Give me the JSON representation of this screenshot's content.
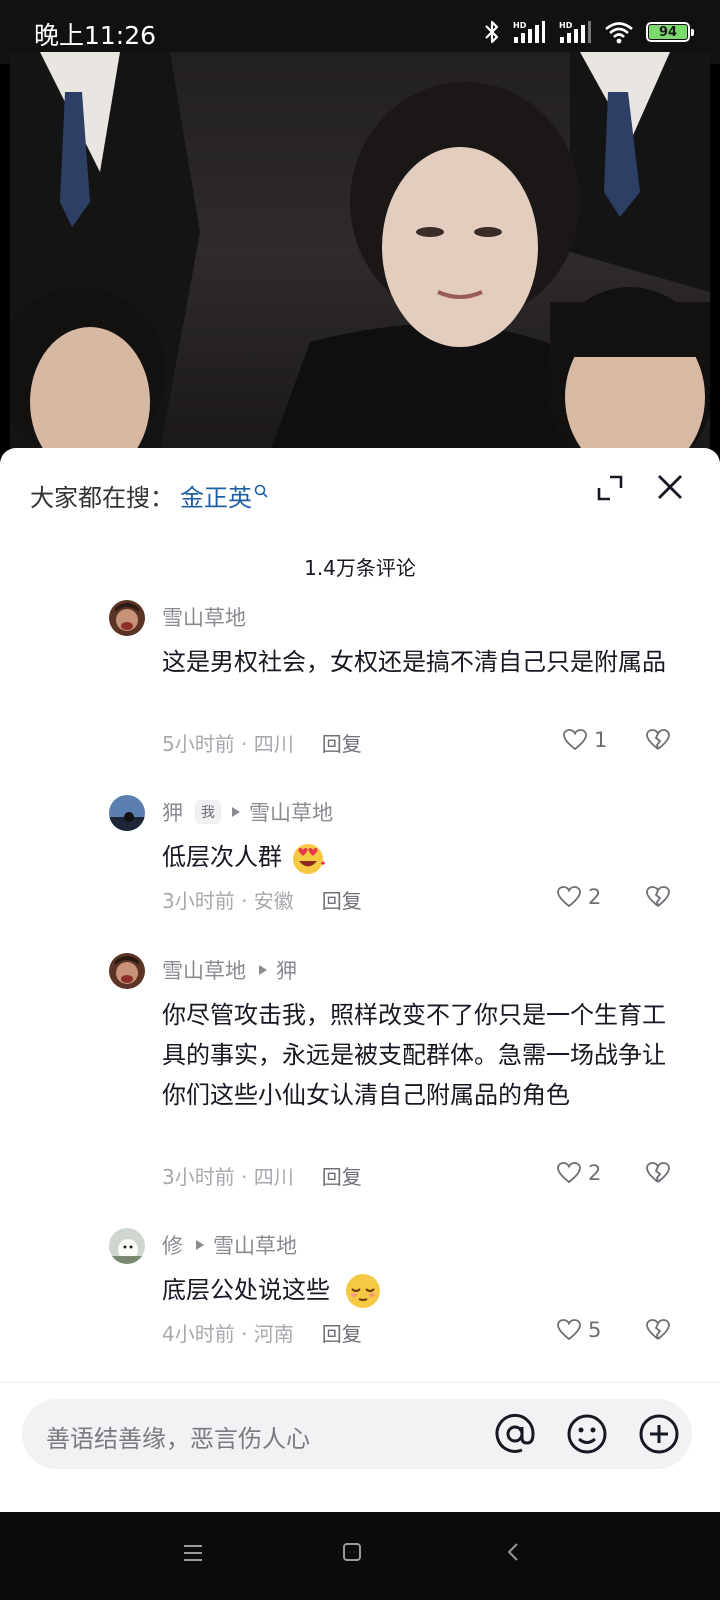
{
  "status_bar": {
    "time": "晚上11:26",
    "battery": "94"
  },
  "hot_search": {
    "prefix": "大家都在搜：",
    "term": "金正英"
  },
  "comments_header": {
    "count": "1.4万条评论"
  },
  "comments": [
    {
      "user": "雪山草地",
      "text": "这是男权社会，女权还是搞不清自己只是附属品",
      "time_location": "5小时前 · 四川",
      "reply_label": "回复",
      "likes": "1"
    },
    {
      "user": "狎",
      "badge": "我",
      "reply_to": "雪山草地",
      "text": "低层次人群",
      "time_location": "3小时前 · 安徽",
      "reply_label": "回复",
      "likes": "2"
    },
    {
      "user": "雪山草地",
      "reply_to": "狎",
      "text": "你尽管攻击我，照样改变不了你只是一个生育工具的事实，永远是被支配群体。急需一场战争让你们这些小仙女认清自己附属品的角色",
      "time_location": "3小时前 · 四川",
      "reply_label": "回复",
      "likes": "2"
    },
    {
      "user": "修",
      "reply_to": "雪山草地",
      "text": "底层公处说这些",
      "time_location": "4小时前 · 河南",
      "reply_label": "回复",
      "likes": "5"
    }
  ],
  "input": {
    "placeholder": "善语结善缘，恶言伤人心"
  }
}
